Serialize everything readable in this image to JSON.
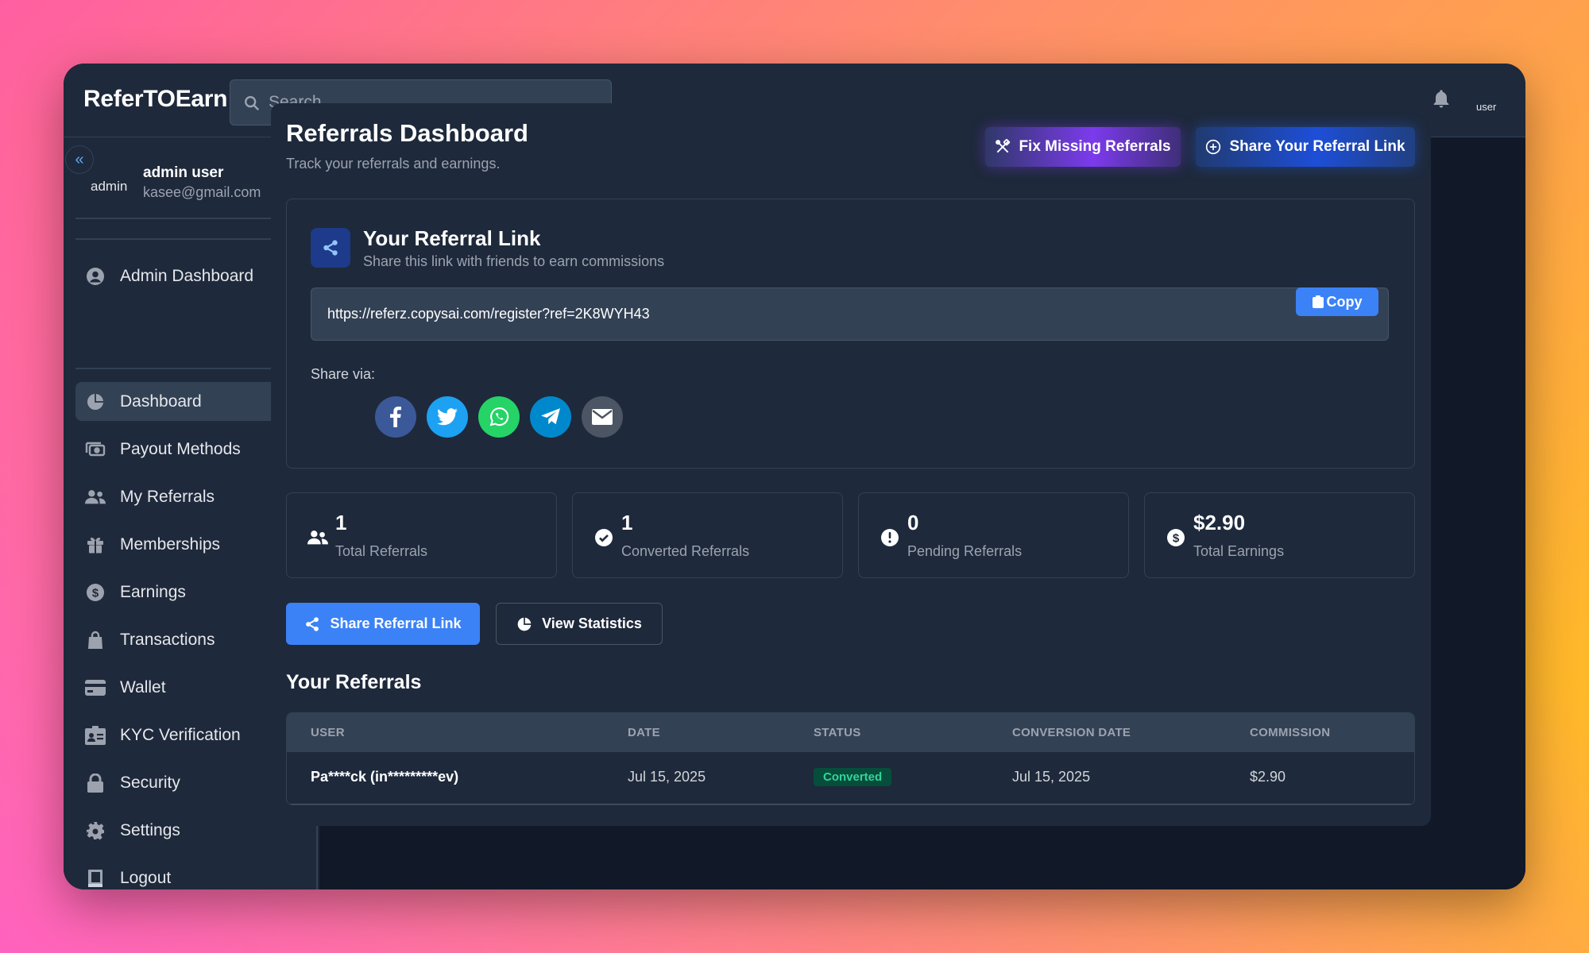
{
  "app": {
    "brand": "ReferTOEarn"
  },
  "search": {
    "placeholder": "Search"
  },
  "top_avatar_alt": "user",
  "sidebar": {
    "collapse_glyph": "«",
    "user_name": "admin user",
    "user_email": "kasee@gmail.com",
    "avatar_alt": "admin",
    "admin_item": {
      "label": "Admin Dashboard",
      "icon": "user-circle-icon"
    },
    "items": [
      {
        "label": "Dashboard",
        "icon": "pie-chart-icon",
        "active": true
      },
      {
        "label": "Payout Methods",
        "icon": "money-icon"
      },
      {
        "label": "My Referrals",
        "icon": "users-icon"
      },
      {
        "label": "Memberships",
        "icon": "gift-icon"
      },
      {
        "label": "Earnings",
        "icon": "dollar-circle-icon"
      },
      {
        "label": "Transactions",
        "icon": "shopping-bag-icon"
      },
      {
        "label": "Wallet",
        "icon": "credit-card-icon"
      },
      {
        "label": "KYC Verification",
        "icon": "id-card-icon"
      },
      {
        "label": "Security",
        "icon": "lock-icon"
      },
      {
        "label": "Settings",
        "icon": "gear-icon"
      },
      {
        "label": "Logout",
        "icon": "logout-icon"
      }
    ]
  },
  "header": {
    "title": "Referrals Dashboard",
    "subtitle": "Track your referrals and earnings.",
    "fix_button": "Fix Missing Referrals",
    "share_button": "Share Your Referral Link"
  },
  "referral_link": {
    "title": "Your Referral Link",
    "subtitle": "Share this link with friends to earn commissions",
    "url": "https://referz.copysai.com/register?ref=2K8WYH43",
    "copy_label": "Copy",
    "share_via": "Share via:",
    "socials": [
      {
        "name": "facebook",
        "icon": "facebook-icon",
        "color": "#3b5998"
      },
      {
        "name": "twitter",
        "icon": "twitter-icon",
        "color": "#1da1f2"
      },
      {
        "name": "whatsapp",
        "icon": "whatsapp-icon",
        "color": "#25d366"
      },
      {
        "name": "telegram",
        "icon": "telegram-icon",
        "color": "#0088cc"
      },
      {
        "name": "email",
        "icon": "mail-icon",
        "color": "#4b5563"
      }
    ]
  },
  "stats": [
    {
      "value": "1",
      "label": "Total Referrals",
      "icon": "users-icon"
    },
    {
      "value": "1",
      "label": "Converted Referrals",
      "icon": "check-circle-icon"
    },
    {
      "value": "0",
      "label": "Pending Referrals",
      "icon": "clock-icon"
    },
    {
      "value": "$2.90",
      "label": "Total Earnings",
      "icon": "dollar-circle-icon"
    }
  ],
  "actions": {
    "share_link": "Share Referral Link",
    "view_stats": "View Statistics"
  },
  "referrals": {
    "title": "Your Referrals",
    "columns": [
      "USER",
      "DATE",
      "STATUS",
      "CONVERSION DATE",
      "COMMISSION"
    ],
    "rows": [
      {
        "user": "Pa****ck (in*********ev)",
        "date": "Jul 15, 2025",
        "status": "Converted",
        "conversion_date": "Jul 15, 2025",
        "commission": "$2.90"
      }
    ]
  },
  "colors": {
    "accent": "#3b82f6",
    "window_bg": "#1e293b",
    "content_bg": "#111827",
    "success": "#34d399"
  }
}
